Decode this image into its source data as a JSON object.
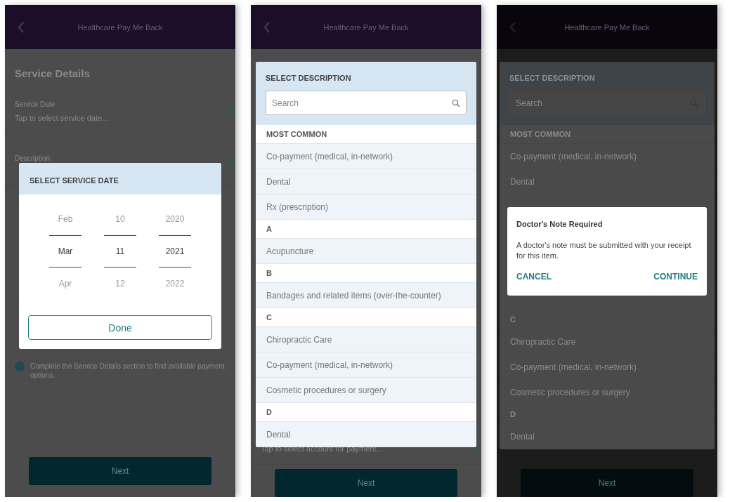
{
  "screens": [
    {
      "kind": "date_picker",
      "header": {
        "title": "Healthcare Pay Me Back"
      },
      "background": {
        "section_title": "Service Details",
        "fields": [
          {
            "label": "Service Date",
            "value": "Tap to select service date..."
          },
          {
            "label": "Description"
          }
        ],
        "info": "Complete the Service Details section to find available payment options.",
        "next_button": "Next"
      },
      "dialog": {
        "title": "SELECT SERVICE DATE",
        "columns": [
          [
            {
              "label": "Feb",
              "selected": false
            },
            {
              "label": "Mar",
              "selected": true
            },
            {
              "label": "Apr",
              "selected": false
            }
          ],
          [
            {
              "label": "10",
              "selected": false
            },
            {
              "label": "11",
              "selected": true
            },
            {
              "label": "12",
              "selected": false
            }
          ],
          [
            {
              "label": "2020",
              "selected": false
            },
            {
              "label": "2021",
              "selected": true
            },
            {
              "label": "2022",
              "selected": false
            }
          ]
        ],
        "done_button": "Done"
      }
    },
    {
      "kind": "description_list",
      "header": {
        "title": "Healthcare Pay Me Back"
      },
      "background": {
        "fields": [
          {
            "value": "Tap to select account for payment..."
          }
        ],
        "next_button": "Next"
      },
      "dialog": {
        "title": "SELECT DESCRIPTION",
        "search_placeholder": "Search",
        "groups": [
          {
            "heading": "MOST COMMON",
            "items": [
              "Co-payment (medical, in-network)",
              "Dental",
              "Rx (prescription)"
            ]
          },
          {
            "heading": "A",
            "items": [
              "Acupuncture"
            ]
          },
          {
            "heading": "B",
            "items": [
              "Bandages and related items (over-the-counter)"
            ]
          },
          {
            "heading": "C",
            "items": [
              "Chiropractic Care",
              "Co-payment (medical, in-network)",
              "Cosmetic procedures or surgery"
            ]
          },
          {
            "heading": "D",
            "items": [
              "Dental"
            ]
          }
        ]
      }
    },
    {
      "kind": "alert",
      "header": {
        "title": "Healthcare Pay Me Back"
      },
      "background": {
        "next_button": "Next",
        "list": {
          "title": "SELECT DESCRIPTION",
          "search_placeholder": "Search",
          "groups": [
            {
              "heading": "MOST COMMON",
              "items": [
                "Co-payment (medical, in-network)",
                "Dental"
              ]
            },
            {
              "heading": "C",
              "items": [
                "Chiropractic Care",
                "Co-payment (medical, in-network)",
                "Cosmetic procedures or surgery"
              ]
            },
            {
              "heading": "D",
              "items": [
                "Dental"
              ]
            }
          ]
        }
      },
      "dialog": {
        "title": "Doctor's Note Required",
        "message": "A doctor's note must be submitted with your receipt for this item.",
        "buttons": [
          "CANCEL",
          "CONTINUE"
        ]
      }
    }
  ]
}
